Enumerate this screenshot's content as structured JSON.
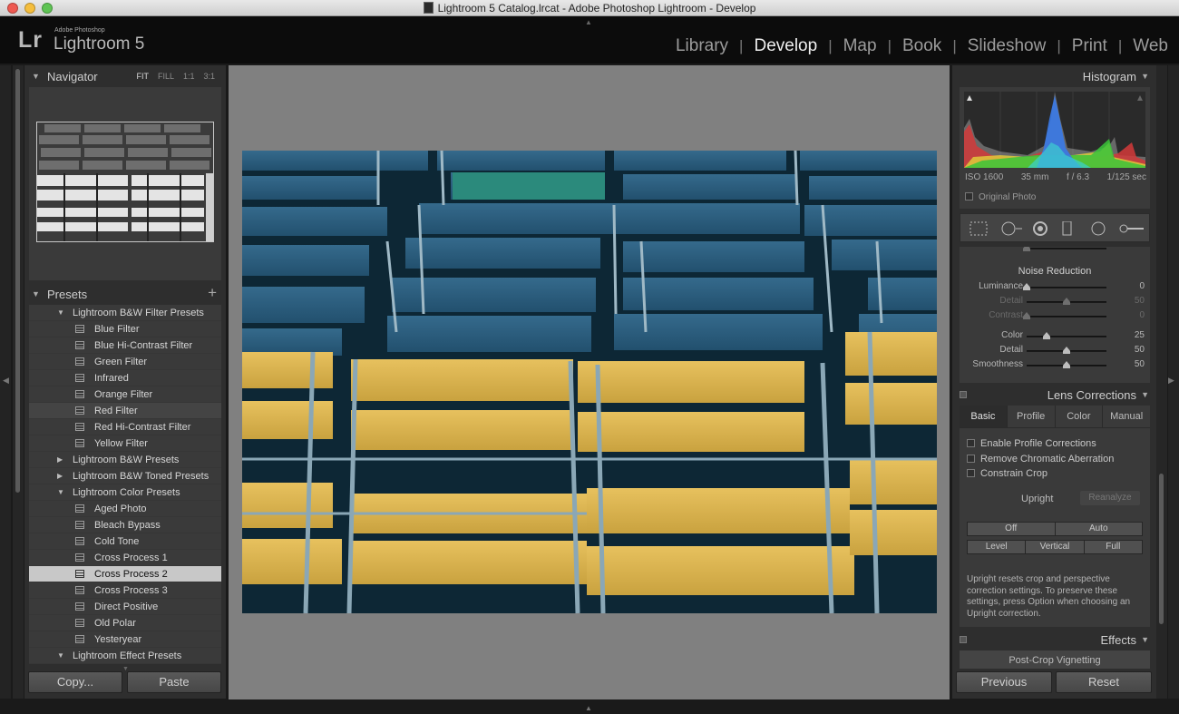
{
  "window": {
    "title": "Lightroom 5 Catalog.lrcat - Adobe Photoshop Lightroom - Develop"
  },
  "app": {
    "logo_mark": "Lr",
    "logo_small": "Adobe Photoshop",
    "logo_name": "Lightroom 5"
  },
  "modules": [
    {
      "label": "Library",
      "active": false
    },
    {
      "label": "Develop",
      "active": true
    },
    {
      "label": "Map",
      "active": false
    },
    {
      "label": "Book",
      "active": false
    },
    {
      "label": "Slideshow",
      "active": false
    },
    {
      "label": "Print",
      "active": false
    },
    {
      "label": "Web",
      "active": false
    }
  ],
  "navigator": {
    "title": "Navigator",
    "zoom_options": [
      "FIT",
      "FILL",
      "1:1",
      "3:1"
    ],
    "active_zoom": "FIT"
  },
  "presets": {
    "title": "Presets",
    "add_symbol": "+",
    "rows": [
      {
        "type": "folder",
        "label": "Lightroom B&W Filter Presets",
        "open": true
      },
      {
        "type": "item",
        "label": "Blue Filter"
      },
      {
        "type": "item",
        "label": "Blue Hi-Contrast Filter"
      },
      {
        "type": "item",
        "label": "Green Filter"
      },
      {
        "type": "item",
        "label": "Infrared"
      },
      {
        "type": "item",
        "label": "Orange Filter"
      },
      {
        "type": "item",
        "label": "Red Filter",
        "hover": true
      },
      {
        "type": "item",
        "label": "Red Hi-Contrast Filter"
      },
      {
        "type": "item",
        "label": "Yellow Filter"
      },
      {
        "type": "folder",
        "label": "Lightroom B&W Presets",
        "open": false
      },
      {
        "type": "folder",
        "label": "Lightroom B&W Toned Presets",
        "open": false
      },
      {
        "type": "folder",
        "label": "Lightroom Color Presets",
        "open": true
      },
      {
        "type": "item",
        "label": "Aged Photo"
      },
      {
        "type": "item",
        "label": "Bleach Bypass"
      },
      {
        "type": "item",
        "label": "Cold Tone"
      },
      {
        "type": "item",
        "label": "Cross Process 1"
      },
      {
        "type": "item",
        "label": "Cross Process 2",
        "selected": true
      },
      {
        "type": "item",
        "label": "Cross Process 3"
      },
      {
        "type": "item",
        "label": "Direct Positive"
      },
      {
        "type": "item",
        "label": "Old Polar"
      },
      {
        "type": "item",
        "label": "Yesteryear"
      },
      {
        "type": "folder",
        "label": "Lightroom Effect Presets",
        "open": true
      }
    ]
  },
  "left_buttons": {
    "copy": "Copy...",
    "paste": "Paste"
  },
  "histogram": {
    "title": "Histogram",
    "iso": "ISO 1600",
    "focal": "35 mm",
    "aperture": "f / 6.3",
    "shutter": "1/125 sec",
    "original_photo": "Original Photo"
  },
  "tools": [
    "crop-overlay-icon",
    "spot-removal-icon",
    "red-eye-icon",
    "graduated-filter-icon",
    "radial-filter-icon",
    "adjustment-brush-icon"
  ],
  "noise_reduction": {
    "title": "Noise Reduction",
    "rows": [
      {
        "label": "Luminance",
        "value": "0",
        "level": 0.0,
        "dim": false
      },
      {
        "label": "Detail",
        "value": "50",
        "level": 0.5,
        "dim": true
      },
      {
        "label": "Contrast",
        "value": "0",
        "level": 0.0,
        "dim": true
      },
      {
        "label": "Color",
        "value": "25",
        "level": 0.25,
        "dim": false
      },
      {
        "label": "Detail",
        "value": "50",
        "level": 0.5,
        "dim": false
      },
      {
        "label": "Smoothness",
        "value": "50",
        "level": 0.5,
        "dim": false
      }
    ]
  },
  "lens_corrections": {
    "title": "Lens Corrections",
    "tabs": [
      {
        "label": "Basic",
        "active": true
      },
      {
        "label": "Profile",
        "active": false
      },
      {
        "label": "Color",
        "active": false
      },
      {
        "label": "Manual",
        "active": false
      }
    ],
    "checks": [
      "Enable Profile Corrections",
      "Remove Chromatic Aberration",
      "Constrain Crop"
    ],
    "upright_label": "Upright",
    "reanalyze": "Reanalyze",
    "upright_row1": [
      "Off",
      "Auto"
    ],
    "upright_row2": [
      "Level",
      "Vertical",
      "Full"
    ],
    "description": "Upright resets crop and perspective correction settings. To preserve these settings, press Option when choosing an Upright correction."
  },
  "effects": {
    "title": "Effects",
    "post_crop": "Post-Crop Vignetting"
  },
  "right_buttons": {
    "previous": "Previous",
    "reset": "Reset"
  },
  "colors": {
    "selected_row": "#c8c8c8",
    "panel": "#2e2e2e",
    "center_bg": "#808080"
  }
}
